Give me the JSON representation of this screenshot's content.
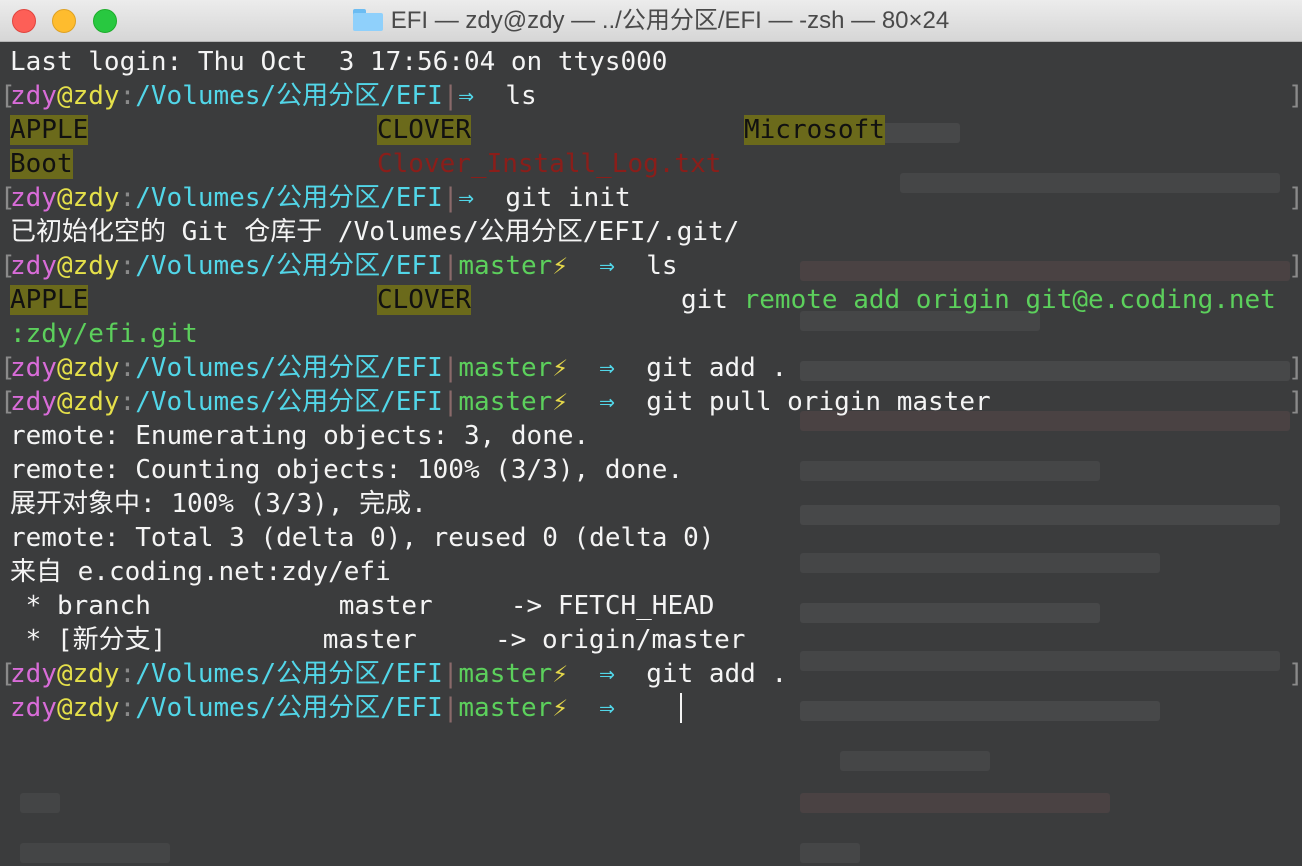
{
  "window": {
    "title": "EFI — zdy@zdy — ../公用分区/EFI — -zsh — 80×24"
  },
  "prompt": {
    "user": "zdy",
    "at": "@",
    "host": "zdy",
    "colon": ":",
    "path": "/Volumes/公用分区/EFI",
    "pipe": "|",
    "branch": "master",
    "dirty_symbol": "⚡",
    "arrow": "⇒",
    "bracket_open": "[",
    "bracket_close": "]"
  },
  "lines": {
    "last_login": "Last login: Thu Oct  3 17:56:04 on ttys000",
    "cmd1": "ls",
    "ls1": {
      "r1c1": "APPLE",
      "r1c2": "CLOVER",
      "r1c3": "Microsoft",
      "r2c1": "Boot",
      "r2c2": "Clover_Install_Log.txt"
    },
    "cmd2": "git init",
    "init_out": "已初始化空的 Git 仓库于 /Volumes/公用分区/EFI/.git/",
    "cmd3": "ls",
    "ls2": {
      "c1": "APPLE",
      "c2": "CLOVER"
    },
    "typed_git": "git",
    "typed_rest": " remote add origin git@e.coding.net",
    "typed_wrap": ":zdy/efi.git",
    "cmd4": "git add .",
    "cmd5": "git pull origin master",
    "out1": "remote: Enumerating objects: 3, done.",
    "out2": "remote: Counting objects: 100% (3/3), done.",
    "out3": "展开对象中: 100% (3/3), 完成.",
    "out4": "remote: Total 3 (delta 0), reused 0 (delta 0)",
    "out5": "来自 e.coding.net:zdy/efi",
    "out6": " * branch            master     -> FETCH_HEAD",
    "out7": " * [新分支]          master     -> origin/master",
    "cmd6": "git add ."
  },
  "colors": {
    "background": "#3b3c3d",
    "user": "#d86cd8",
    "path": "#52d6e8",
    "branch": "#5cd05c",
    "dir_bg": "#6b6a1b"
  }
}
